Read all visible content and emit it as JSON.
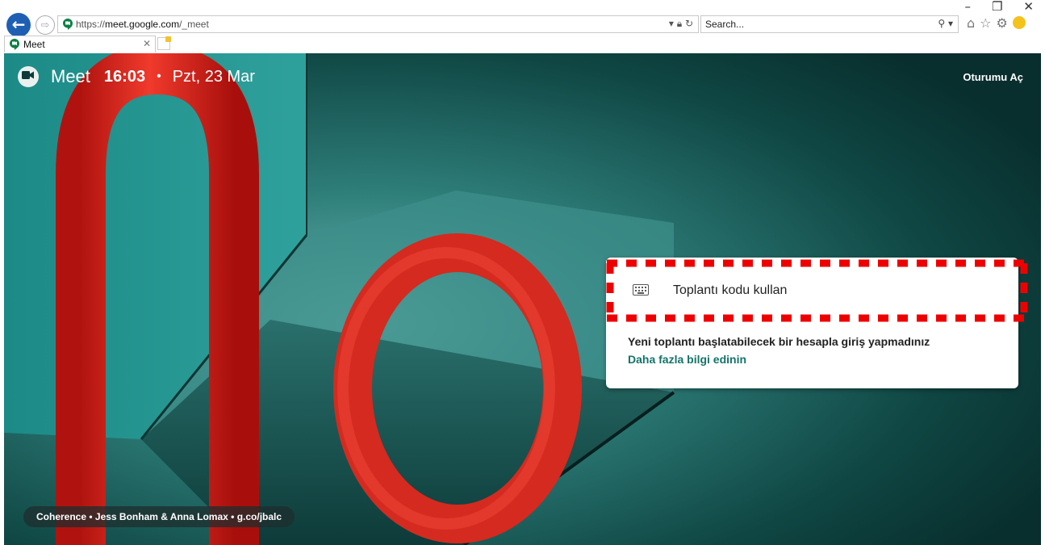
{
  "browser": {
    "address_url_prefix": "https://",
    "address_url_host": "meet.google.com",
    "address_url_path": "/_meet",
    "search_placeholder": "Search...",
    "tab_title": "Meet",
    "window_controls": [
      "–",
      "❐",
      "✕"
    ]
  },
  "header": {
    "brand": "Meet",
    "time": "16:03",
    "separator": "•",
    "date": "Pzt, 23 Mar",
    "signin": "Oturumu Aç"
  },
  "card": {
    "code_label": "Toplantı kodu kullan",
    "info_text": "Yeni toplantı başlatabilecek bir hesapla giriş yapmadınız",
    "more_link": "Daha fazla bilgi edinin"
  },
  "credit": "Coherence  •  Jess Bonham & Anna Lomax  •  g.co/jbalc",
  "colors": {
    "accent_teal": "#137468",
    "highlight_red": "#ee0000",
    "background_dark": "#0e3a38",
    "browser_back": "#1e5fb4"
  },
  "icons": {
    "back": "back-arrow-icon",
    "forward": "forward-arrow-icon",
    "lock": "lock-icon",
    "refresh": "refresh-icon",
    "search": "search-icon",
    "home": "home-icon",
    "favorites": "star-icon",
    "settings": "gear-icon",
    "feedback": "smiley-icon",
    "keyboard": "keyboard-icon",
    "meet": "meet-logo-icon"
  }
}
